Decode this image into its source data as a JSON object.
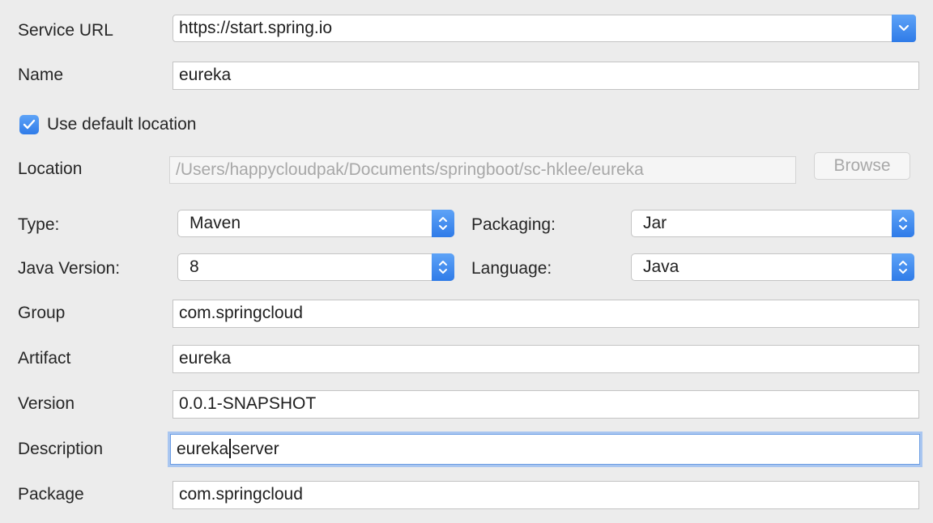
{
  "service_url": {
    "label": "Service URL",
    "value": "https://start.spring.io"
  },
  "name": {
    "label": "Name",
    "value": "eureka"
  },
  "use_default_location": {
    "label": "Use default location",
    "checked": true
  },
  "location": {
    "label": "Location",
    "value": "/Users/happycloudpak/Documents/springboot/sc-hklee/eureka",
    "browse_label": "Browse"
  },
  "type": {
    "label": "Type:",
    "value": "Maven"
  },
  "packaging": {
    "label": "Packaging:",
    "value": "Jar"
  },
  "java_version": {
    "label": "Java Version:",
    "value": "8"
  },
  "language": {
    "label": "Language:",
    "value": "Java"
  },
  "group": {
    "label": "Group",
    "value": "com.springcloud"
  },
  "artifact": {
    "label": "Artifact",
    "value": "eureka"
  },
  "version": {
    "label": "Version",
    "value": "0.0.1-SNAPSHOT"
  },
  "description": {
    "label": "Description",
    "value_before_cursor": "eureka",
    "value_after_cursor": "server"
  },
  "package": {
    "label": "Package",
    "value": "com.springcloud"
  },
  "colors": {
    "accent": "#3b82f0",
    "focus_ring": "#a9c6f0",
    "disabled_text": "#a8a8a8"
  },
  "icons": {
    "select_button": "chevron-updown-icon",
    "url_dropdown": "chevron-down-icon",
    "checkbox": "checkmark-icon"
  }
}
